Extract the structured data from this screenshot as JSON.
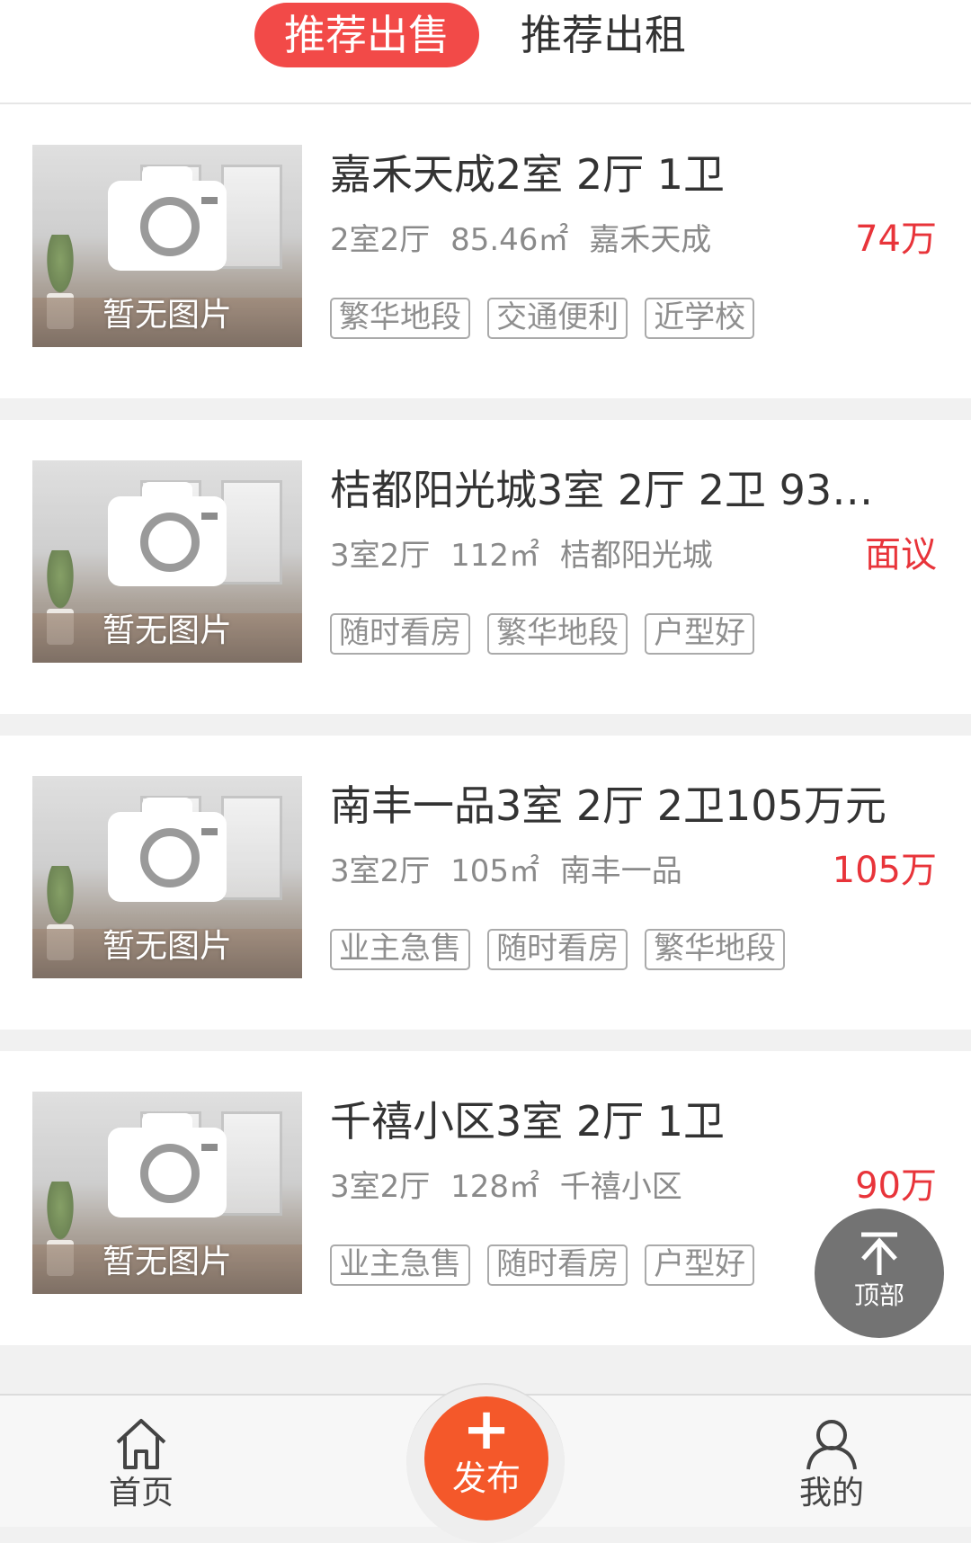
{
  "tabs": {
    "sale": "推荐出售",
    "rent": "推荐出租"
  },
  "listings": [
    {
      "no_image_text": "暂无图片",
      "title": "嘉禾天成2室 2厅 1卫",
      "layout": "2室2厅",
      "area": "85.46㎡",
      "community": "嘉禾天成",
      "price": "74万",
      "tags": [
        "繁华地段",
        "交通便利",
        "近学校"
      ]
    },
    {
      "no_image_text": "暂无图片",
      "title": "桔都阳光城3室 2厅 2卫 930...",
      "layout": "3室2厅",
      "area": "112㎡",
      "community": "桔都阳光城",
      "price": "面议",
      "tags": [
        "随时看房",
        "繁华地段",
        "户型好"
      ]
    },
    {
      "no_image_text": "暂无图片",
      "title": "南丰一品3室 2厅 2卫105万元",
      "layout": "3室2厅",
      "area": "105㎡",
      "community": "南丰一品",
      "price": "105万",
      "tags": [
        "业主急售",
        "随时看房",
        "繁华地段"
      ]
    },
    {
      "no_image_text": "暂无图片",
      "title": "千禧小区3室 2厅 1卫",
      "layout": "3室2厅",
      "area": "128㎡",
      "community": "千禧小区",
      "price": "90万",
      "tags": [
        "业主急售",
        "随时看房",
        "户型好"
      ]
    }
  ],
  "back_to_top": {
    "label": "顶部",
    "icon": "arrow-up-icon"
  },
  "bottom_nav": {
    "home": {
      "label": "首页",
      "icon": "home-icon"
    },
    "publish": {
      "label": "发布",
      "symbol": "+",
      "icon": "plus-icon"
    },
    "mine": {
      "label": "我的",
      "icon": "user-icon"
    }
  },
  "colors": {
    "accent_red": "#f24a48",
    "price_red": "#e8343a",
    "publish_orange": "#f4582a",
    "to_top_gray": "#737373"
  }
}
